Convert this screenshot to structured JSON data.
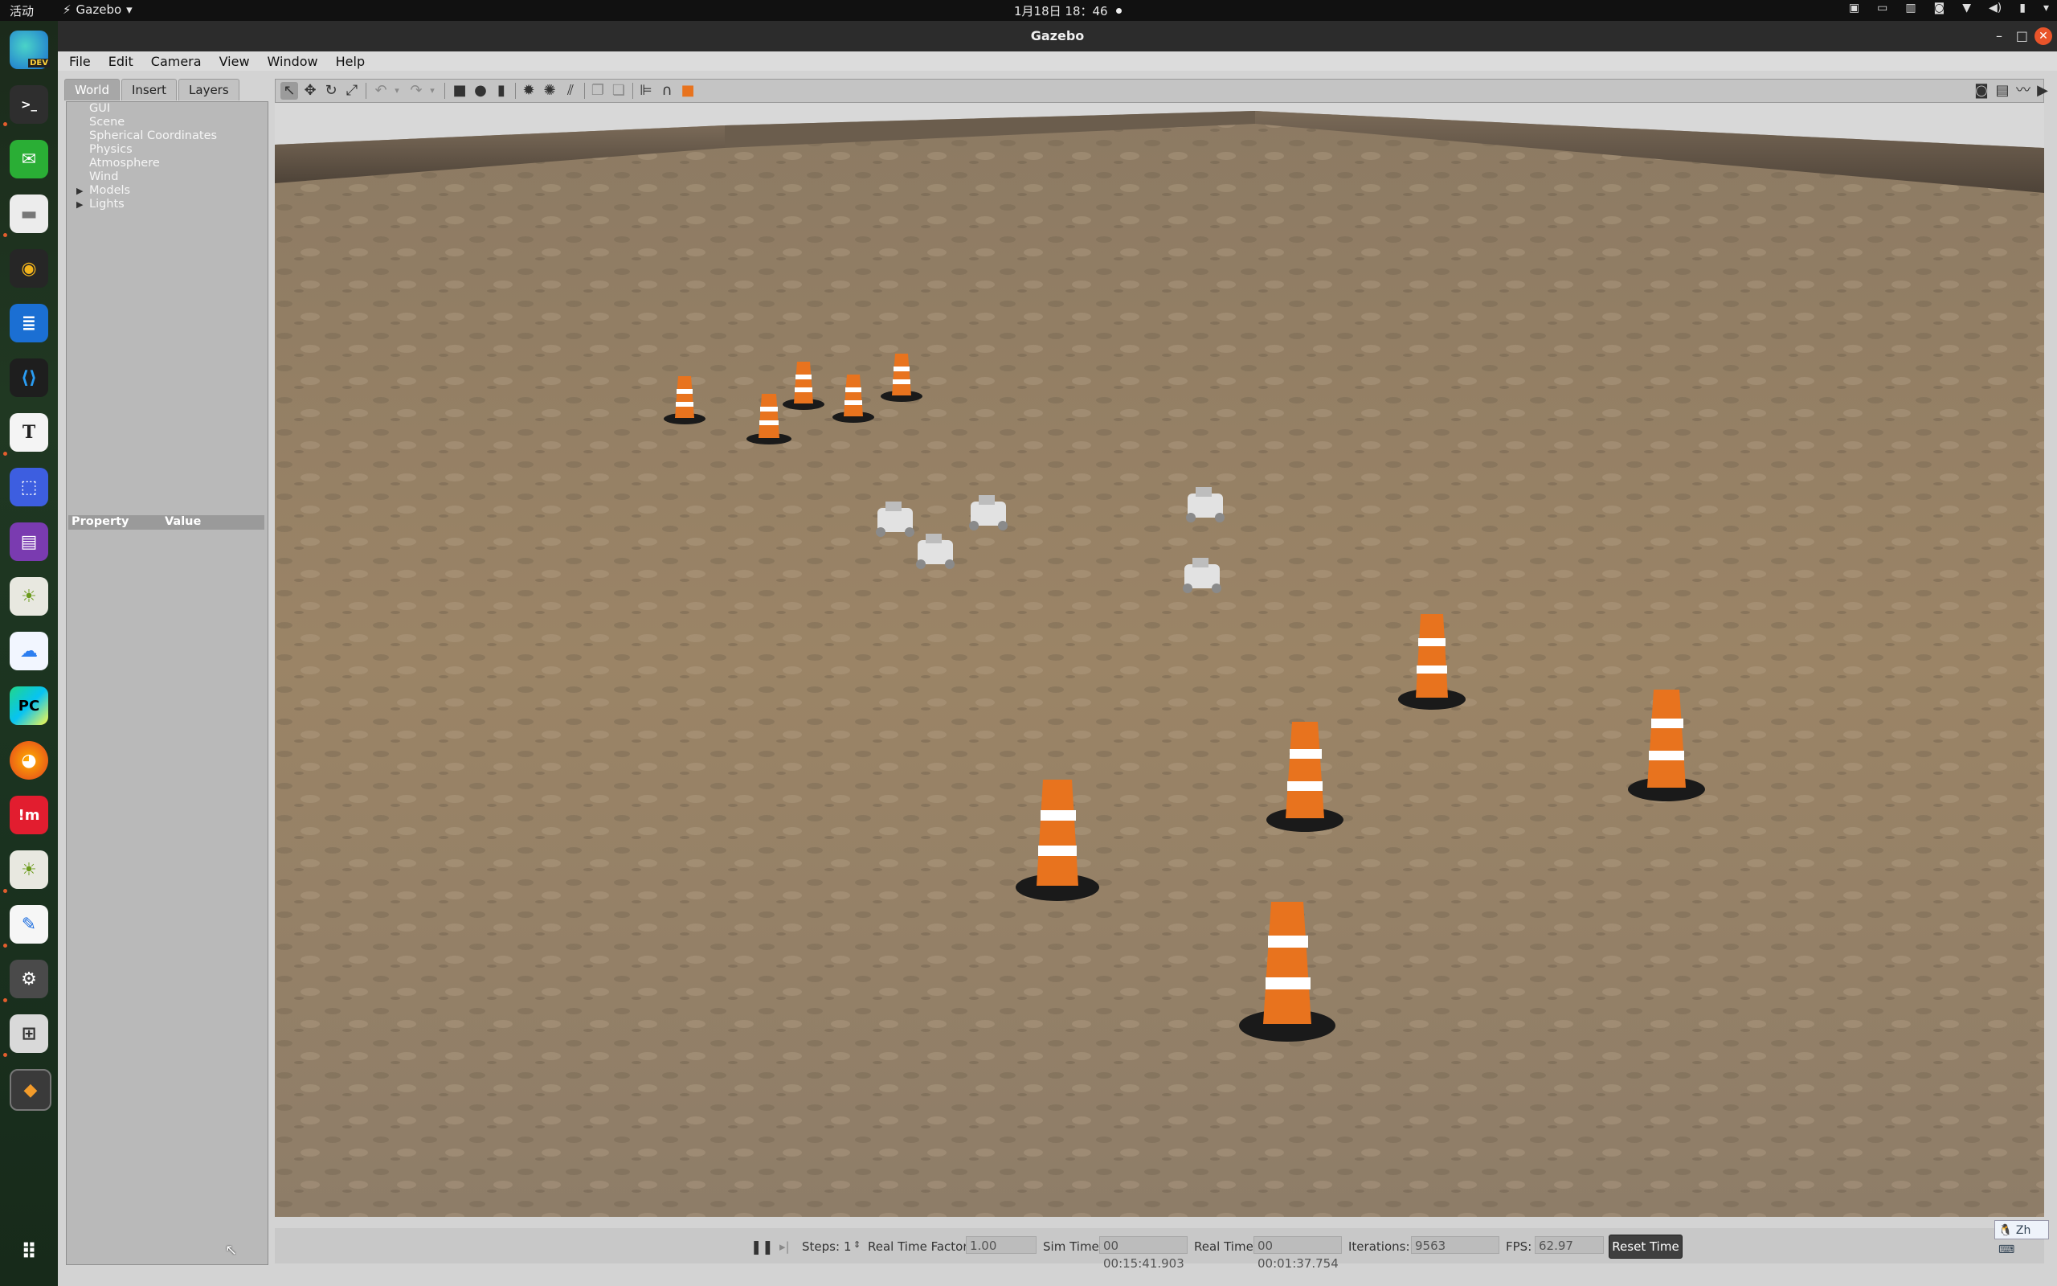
{
  "topbar": {
    "activities": "活动",
    "app_name": "Gazebo",
    "app_caret": "▾",
    "clock": "1月18日  18：46",
    "tray_icons": [
      "camera-icon",
      "screen-icon",
      "ime-icon",
      "tray-app-icon",
      "wifi-icon",
      "volume-icon",
      "battery-icon",
      "chevron-down-icon"
    ]
  },
  "dock": {
    "items": [
      "edge-dev",
      "terminal",
      "wechat",
      "files",
      "rhythmbox",
      "writer",
      "vscode",
      "text-editor",
      "screenshot",
      "video",
      "weather",
      "baidu-netdisk",
      "pycharm",
      "firefox",
      "meituan",
      "weather-2",
      "notes",
      "settings",
      "game",
      "gazebo",
      "app-grid"
    ],
    "edge_badge": "DEV",
    "pycharm_label": "PC"
  },
  "window": {
    "title": "Gazebo",
    "minimize": "–",
    "maximize": "□",
    "close": "✕"
  },
  "menu": [
    "File",
    "Edit",
    "Camera",
    "View",
    "Window",
    "Help"
  ],
  "left_panel": {
    "tabs": [
      "World",
      "Insert",
      "Layers"
    ],
    "active_tab": "World",
    "tree": [
      {
        "label": "GUI",
        "expandable": false
      },
      {
        "label": "Scene",
        "expandable": false
      },
      {
        "label": "Spherical Coordinates",
        "expandable": false
      },
      {
        "label": "Physics",
        "expandable": false
      },
      {
        "label": "Atmosphere",
        "expandable": false
      },
      {
        "label": "Wind",
        "expandable": false
      },
      {
        "label": "Models",
        "expandable": true
      },
      {
        "label": "Lights",
        "expandable": true
      }
    ],
    "property_header": "Property",
    "value_header": "Value"
  },
  "status": {
    "steps_label": "Steps:",
    "steps_value": "1",
    "rtf_label": "Real Time Factor:",
    "rtf_value": "1.00",
    "sim_time_label": "Sim Time:",
    "sim_time_value": "00 00:15:41.903",
    "real_time_label": "Real Time:",
    "real_time_value": "00 00:01:37.754",
    "iterations_label": "Iterations:",
    "iterations_value": "9563",
    "fps_label": "FPS:",
    "fps_value": "62.97",
    "reset_label": "Reset Time"
  },
  "ime": {
    "text": "Zh"
  },
  "colors": {
    "accent": "#e9542a",
    "cone_orange": "#e8731e",
    "ground": "#9b8466"
  }
}
